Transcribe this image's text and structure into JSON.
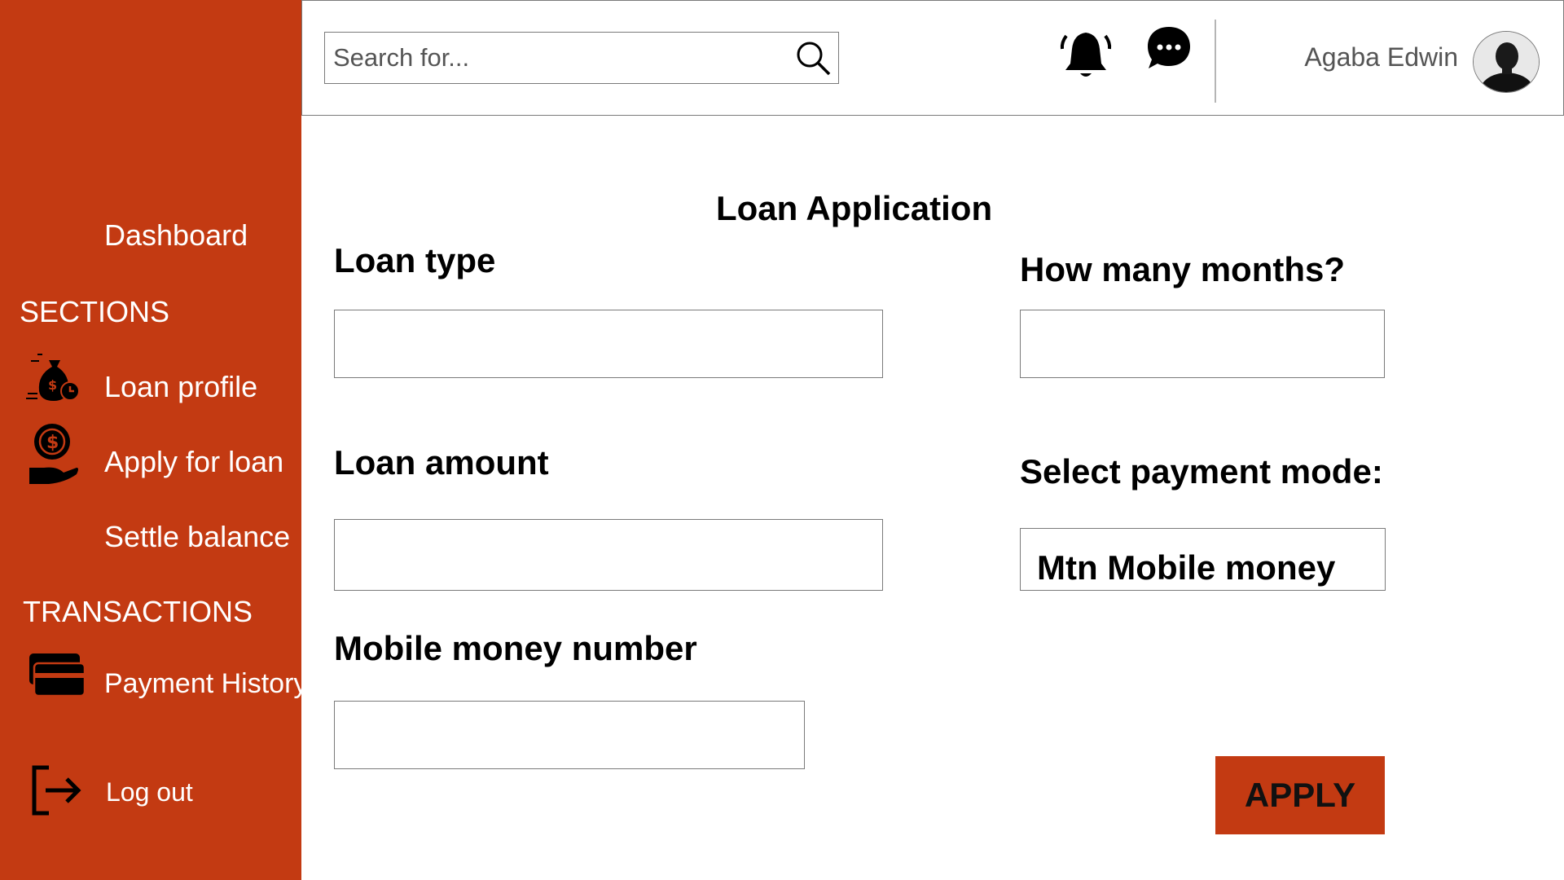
{
  "search": {
    "placeholder": "Search for..."
  },
  "header": {
    "username": "Agaba Edwin"
  },
  "sidebar": {
    "dashboard": "Dashboard",
    "sections_heading": "SECTIONS",
    "loan_profile": "Loan profile",
    "apply_for_loan": "Apply for loan",
    "settle_balance": "Settle balance",
    "transactions_heading": "TRANSACTIONS",
    "payment_history": "Payment History",
    "log_out": "Log out"
  },
  "form": {
    "title": "Loan Application",
    "loan_type_label": "Loan type",
    "months_label": "How many months?",
    "loan_amount_label": "Loan amount",
    "payment_mode_label": "Select payment mode:",
    "payment_mode_value": "Mtn Mobile money",
    "mobile_number_label": "Mobile money number",
    "apply_label": "APPLY"
  },
  "colors": {
    "accent": "#c33a12",
    "border": "#7a7a7a"
  },
  "icons": [
    "money-bag-clock-icon",
    "hand-dollar-icon",
    "credit-cards-icon",
    "logout-icon",
    "search-icon",
    "bell-icon",
    "chat-icon"
  ]
}
